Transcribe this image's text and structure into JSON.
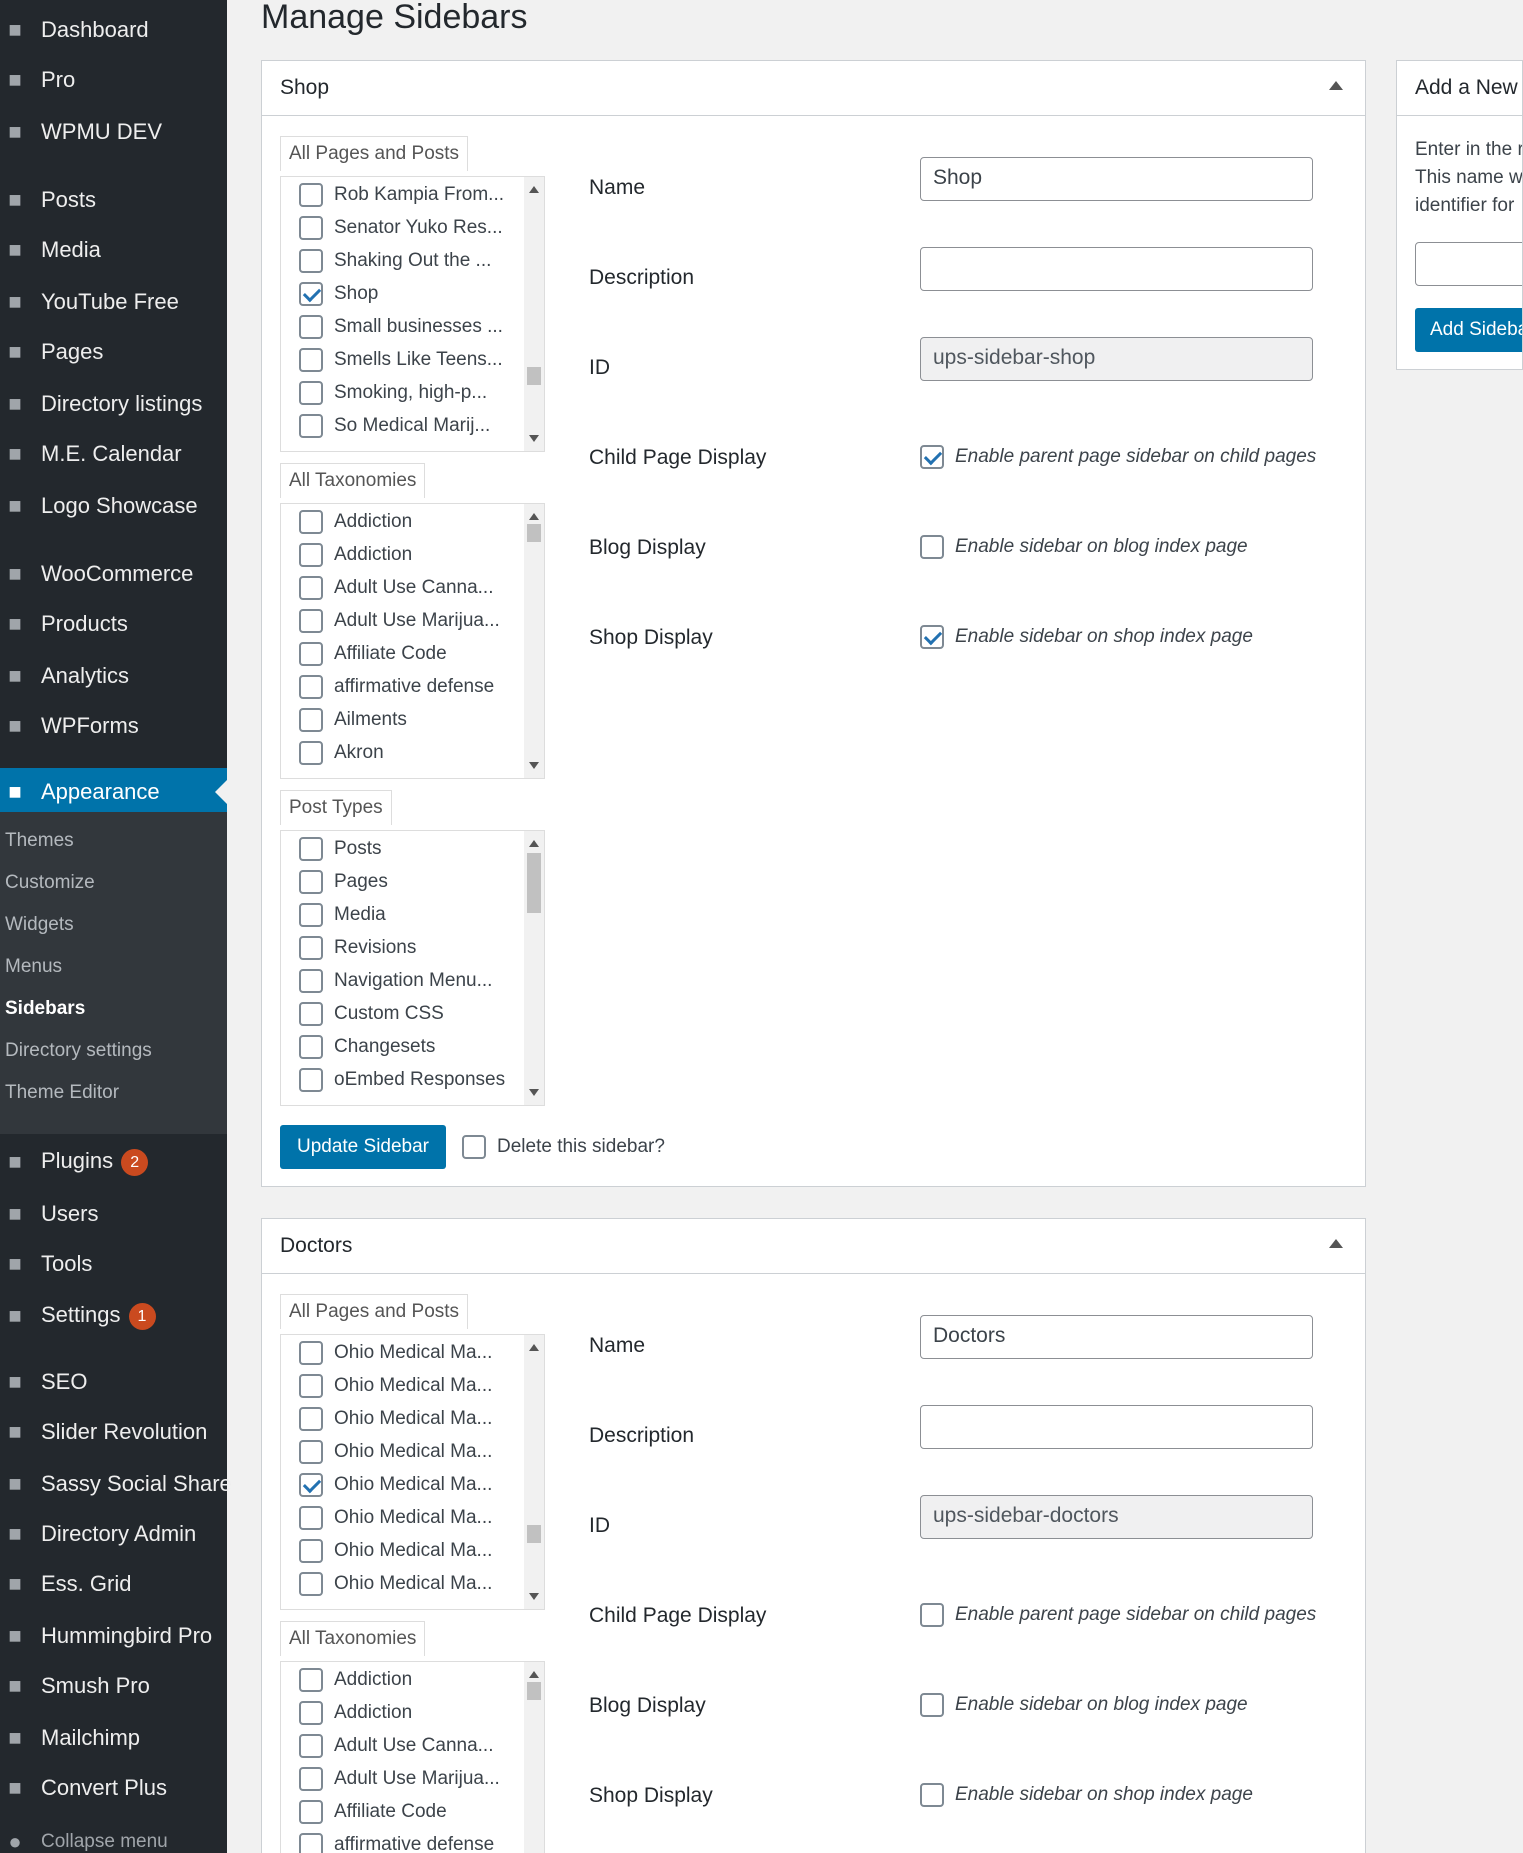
{
  "menu": {
    "top_items": [
      {
        "label": "Dashboard",
        "icon": "dashboard-icon"
      },
      {
        "label": "Pro",
        "icon": "chevron-right-icon"
      },
      {
        "label": "WPMU DEV",
        "icon": "wpmudev-icon"
      },
      {
        "label": "Posts",
        "icon": "pin-icon"
      },
      {
        "label": "Media",
        "icon": "media-icon"
      },
      {
        "label": "YouTube Free",
        "icon": "youtube-icon"
      },
      {
        "label": "Pages",
        "icon": "pages-icon"
      },
      {
        "label": "Directory listings",
        "icon": "directory-icon"
      },
      {
        "label": "M.E. Calendar",
        "icon": "calendar-icon"
      },
      {
        "label": "Logo Showcase",
        "icon": "logo-showcase-icon"
      },
      {
        "label": "WooCommerce",
        "icon": "woo-icon"
      },
      {
        "label": "Products",
        "icon": "products-icon"
      },
      {
        "label": "Analytics",
        "icon": "analytics-icon"
      },
      {
        "label": "WPForms",
        "icon": "wpforms-icon"
      },
      {
        "label": "Appearance",
        "icon": "brush-icon"
      }
    ],
    "sub_items": [
      "Themes",
      "Customize",
      "Widgets",
      "Menus",
      "Sidebars",
      "Directory settings",
      "Theme Editor"
    ],
    "bottom_items": [
      {
        "label": "Plugins",
        "badge": "2",
        "icon": "plugins-icon"
      },
      {
        "label": "Users",
        "icon": "users-icon"
      },
      {
        "label": "Tools",
        "icon": "tools-icon"
      },
      {
        "label": "Settings",
        "badge": "1",
        "icon": "settings-icon"
      },
      {
        "label": "SEO",
        "icon": "seo-icon"
      },
      {
        "label": "Slider Revolution",
        "icon": "slider-icon"
      },
      {
        "label": "Sassy Social Share",
        "icon": "share-icon"
      },
      {
        "label": "Directory Admin",
        "icon": "directory-admin-icon"
      },
      {
        "label": "Ess. Grid",
        "icon": "grid-icon"
      },
      {
        "label": "Hummingbird Pro",
        "icon": "hummingbird-icon"
      },
      {
        "label": "Smush Pro",
        "icon": "smush-icon"
      },
      {
        "label": "Mailchimp",
        "icon": "mailchimp-icon"
      },
      {
        "label": "Convert Plus",
        "icon": "convert-icon"
      },
      {
        "label": "Collapse menu",
        "icon": "collapse-icon"
      }
    ],
    "accent": "#0073aa"
  },
  "page": {
    "title": "Manage Sidebars"
  },
  "labels": {
    "name": "Name",
    "description": "Description",
    "id": "ID",
    "child_page_display": "Child Page Display",
    "blog_display": "Blog Display",
    "shop_display": "Shop Display",
    "child_opt": "Enable parent page sidebar on child pages",
    "blog_opt": "Enable sidebar on blog index page",
    "shop_opt": "Enable sidebar on shop index page",
    "tab_pages": "All Pages and Posts",
    "tab_taxonomies": "All Taxonomies",
    "tab_post_types": "Post Types",
    "update_button": "Update Sidebar",
    "delete_label": "Delete this sidebar?"
  },
  "sidebars": [
    {
      "title": "Shop",
      "name": "Shop",
      "description": "",
      "id": "ups-sidebar-shop",
      "child_enabled": true,
      "blog_enabled": false,
      "shop_enabled": true,
      "pages": [
        {
          "label": "Rob Kampia From...",
          "checked": false
        },
        {
          "label": "Senator Yuko Res...",
          "checked": false
        },
        {
          "label": "Shaking Out the ...",
          "checked": false
        },
        {
          "label": "Shop",
          "checked": true
        },
        {
          "label": "Small businesses ...",
          "checked": false
        },
        {
          "label": "Smells Like Teens...",
          "checked": false
        },
        {
          "label": "Smoking, high-p...",
          "checked": false
        },
        {
          "label": "So Medical Marij...",
          "checked": false
        }
      ],
      "taxonomies": [
        {
          "label": "Addiction",
          "checked": false
        },
        {
          "label": "Addiction",
          "checked": false
        },
        {
          "label": "Adult Use Canna...",
          "checked": false
        },
        {
          "label": "Adult Use Marijua...",
          "checked": false
        },
        {
          "label": "Affiliate Code",
          "checked": false
        },
        {
          "label": "affirmative defense",
          "checked": false
        },
        {
          "label": "Ailments",
          "checked": false
        },
        {
          "label": "Akron",
          "checked": false
        }
      ],
      "post_types": [
        {
          "label": "Posts",
          "checked": false
        },
        {
          "label": "Pages",
          "checked": false
        },
        {
          "label": "Media",
          "checked": false
        },
        {
          "label": "Revisions",
          "checked": false
        },
        {
          "label": "Navigation Menu...",
          "checked": false
        },
        {
          "label": "Custom CSS",
          "checked": false
        },
        {
          "label": "Changesets",
          "checked": false
        },
        {
          "label": "oEmbed Responses",
          "checked": false
        }
      ]
    },
    {
      "title": "Doctors",
      "name": "Doctors",
      "description": "",
      "id": "ups-sidebar-doctors",
      "child_enabled": false,
      "blog_enabled": false,
      "shop_enabled": false,
      "pages": [
        {
          "label": "Ohio Medical Ma...",
          "checked": false
        },
        {
          "label": "Ohio Medical Ma...",
          "checked": false
        },
        {
          "label": "Ohio Medical Ma...",
          "checked": false
        },
        {
          "label": "Ohio Medical Ma...",
          "checked": false
        },
        {
          "label": "Ohio Medical Ma...",
          "checked": true
        },
        {
          "label": "Ohio Medical Ma...",
          "checked": false
        },
        {
          "label": "Ohio Medical Ma...",
          "checked": false
        },
        {
          "label": "Ohio Medical Ma...",
          "checked": false
        }
      ],
      "taxonomies": [
        {
          "label": "Addiction",
          "checked": false
        },
        {
          "label": "Addiction",
          "checked": false
        },
        {
          "label": "Adult Use Canna...",
          "checked": false
        },
        {
          "label": "Adult Use Marijua...",
          "checked": false
        },
        {
          "label": "Affiliate Code",
          "checked": false
        },
        {
          "label": "affirmative defense",
          "checked": false
        }
      ]
    }
  ],
  "add_new": {
    "title": "Add a New",
    "text_lines": [
      "Enter in the r",
      "This name w",
      "identifier for"
    ],
    "button": "Add Sideba"
  }
}
